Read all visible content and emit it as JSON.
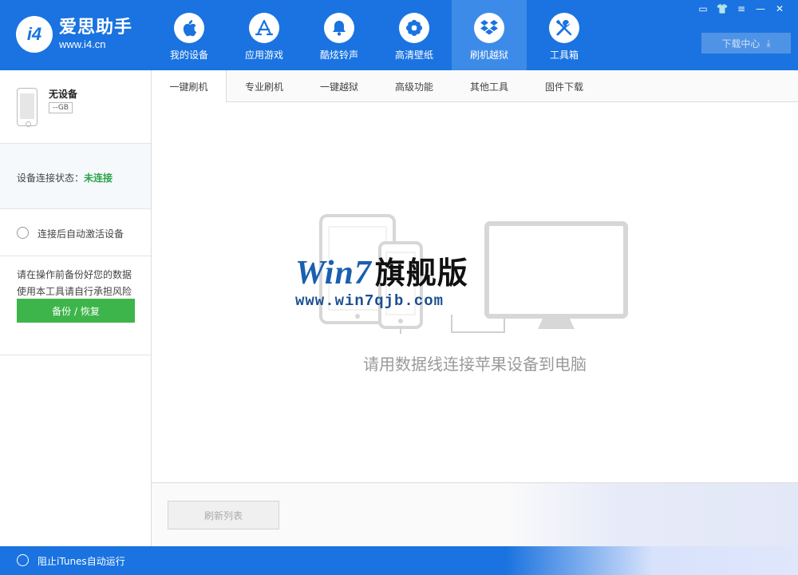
{
  "header": {
    "logo_badge": "i4",
    "logo_title": "爱思助手",
    "logo_url": "www.i4.cn",
    "nav": [
      {
        "label": "我的设备",
        "icon": "apple-icon"
      },
      {
        "label": "应用游戏",
        "icon": "app-store-icon"
      },
      {
        "label": "酷炫铃声",
        "icon": "bell-icon"
      },
      {
        "label": "高清壁纸",
        "icon": "flower-icon"
      },
      {
        "label": "刷机越狱",
        "icon": "dropbox-icon",
        "active": true
      },
      {
        "label": "工具箱",
        "icon": "tools-icon"
      }
    ],
    "window_controls": [
      "▭",
      "👕",
      "≡",
      "—",
      "✕"
    ],
    "download_label": "下载中心",
    "download_icon": "⤓"
  },
  "sidebar": {
    "device_name": "无设备",
    "device_capacity": "--GB",
    "status_label": "设备连接状态：",
    "status_value": "未连接",
    "auto_activate_label": "连接后自动激活设备",
    "warning_line1": "请在操作前备份好您的数据",
    "warning_line2": "使用本工具请自行承担风险",
    "backup_button": "备份 / 恢复"
  },
  "tabs": [
    {
      "label": "一键刷机",
      "active": true
    },
    {
      "label": "专业刷机"
    },
    {
      "label": "一键越狱"
    },
    {
      "label": "高级功能"
    },
    {
      "label": "其他工具"
    },
    {
      "label": "固件下载"
    }
  ],
  "main": {
    "hint": "请用数据线连接苹果设备到电脑",
    "refresh_button": "刷新列表"
  },
  "watermark": {
    "title_latin": "Win7",
    "title_cn": "旗舰版",
    "url": "www.win7qjb.com"
  },
  "footer": {
    "itunes_label": "阻止iTunes自动运行"
  },
  "colors": {
    "brand_blue": "#1a73e0",
    "active_tab_blue": "#3d8be8",
    "status_green": "#2ca34b",
    "button_green": "#3eb54a"
  }
}
